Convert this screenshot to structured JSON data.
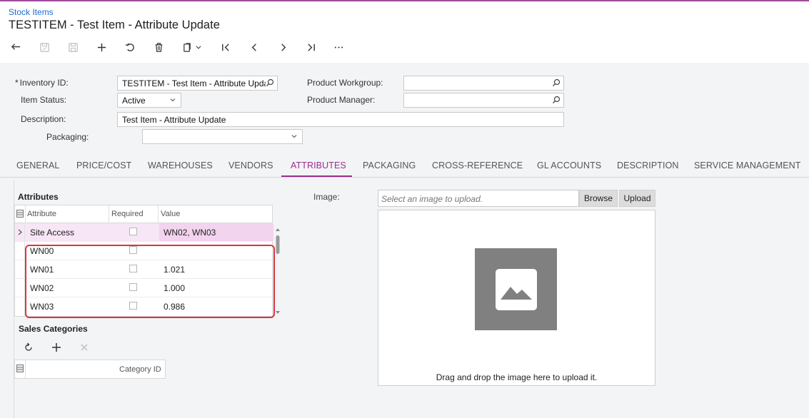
{
  "header": {
    "breadcrumb": "Stock Items",
    "title": "TESTITEM - Test Item - Attribute Update"
  },
  "form": {
    "inventory_id_label": "Inventory ID:",
    "inventory_id_required": "*",
    "inventory_id_value": "TESTITEM - Test Item - Attribute Upda",
    "item_status_label": "Item Status:",
    "item_status_value": "Active",
    "description_label": "Description:",
    "description_value": "Test Item - Attribute Update",
    "packaging_label": "Packaging:",
    "packaging_value": "",
    "product_workgroup_label": "Product Workgroup:",
    "product_workgroup_value": "",
    "product_manager_label": "Product Manager:",
    "product_manager_value": ""
  },
  "tabs": [
    {
      "label": "GENERAL"
    },
    {
      "label": "PRICE/COST"
    },
    {
      "label": "WAREHOUSES"
    },
    {
      "label": "VENDORS"
    },
    {
      "label": "ATTRIBUTES"
    },
    {
      "label": "PACKAGING"
    },
    {
      "label": "CROSS-REFERENCE"
    },
    {
      "label": "GL ACCOUNTS"
    },
    {
      "label": "DESCRIPTION"
    },
    {
      "label": "SERVICE MANAGEMENT"
    }
  ],
  "active_tab": "ATTRIBUTES",
  "attributes": {
    "title": "Attributes",
    "columns": [
      "Attribute",
      "Required",
      "Value"
    ],
    "rows": [
      {
        "attribute": "Site Access",
        "value": "WN02, WN03"
      },
      {
        "attribute": "WN00",
        "value": ""
      },
      {
        "attribute": "WN01",
        "value": "1.021"
      },
      {
        "attribute": "WN02",
        "value": "1.000"
      },
      {
        "attribute": "WN03",
        "value": "0.986"
      }
    ]
  },
  "sales_categories": {
    "title": "Sales Categories",
    "columns": [
      "Category ID"
    ]
  },
  "image": {
    "label": "Image:",
    "upload_placeholder": "Select an image to upload.",
    "browse_label": "Browse",
    "upload_label": "Upload",
    "drop_text": "Drag and drop the image here to upload it."
  },
  "colors": {
    "accent": "#9c2f8f",
    "link": "#1f6bd1",
    "highlight_box": "#d9363e",
    "selected_row": "#f7e6f5"
  }
}
